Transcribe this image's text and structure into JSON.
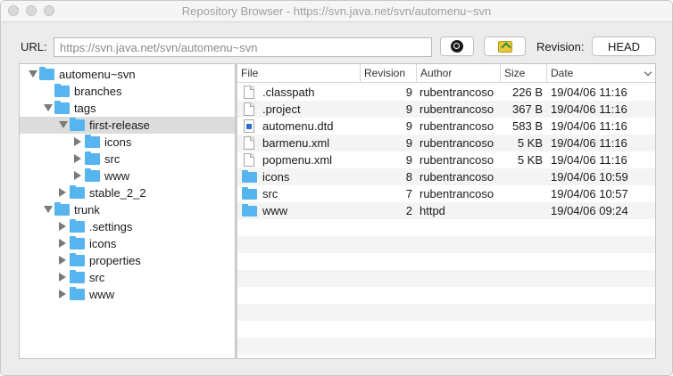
{
  "window": {
    "title": "Repository Browser - https://svn.java.net/svn/automenu~svn"
  },
  "toolbar": {
    "url_label": "URL:",
    "url_value": "https://svn.java.net/svn/automenu~svn",
    "search_icon": "search-icon",
    "open_icon": "open-folder-icon",
    "revision_label": "Revision:",
    "revision_button": "HEAD"
  },
  "tree": {
    "items": [
      {
        "label": "automenu~svn",
        "expander": "down"
      },
      {
        "label": "branches",
        "expander": "none"
      },
      {
        "label": "tags",
        "expander": "down"
      },
      {
        "label": "first-release",
        "expander": "down",
        "selected": true
      },
      {
        "label": "icons",
        "expander": "right"
      },
      {
        "label": "src",
        "expander": "right"
      },
      {
        "label": "www",
        "expander": "right"
      },
      {
        "label": "stable_2_2",
        "expander": "right"
      },
      {
        "label": "trunk",
        "expander": "down"
      },
      {
        "label": ".settings",
        "expander": "right"
      },
      {
        "label": "icons",
        "expander": "right"
      },
      {
        "label": "properties",
        "expander": "right"
      },
      {
        "label": "src",
        "expander": "right"
      },
      {
        "label": "www",
        "expander": "right"
      }
    ]
  },
  "files": {
    "columns": [
      "File",
      "Revision",
      "Author",
      "Size",
      "Date"
    ],
    "rows": [
      {
        "name": ".classpath",
        "icon": "document-icon",
        "revision": "9",
        "author": "rubentrancoso",
        "size": "226 B",
        "date": "19/04/06 11:16"
      },
      {
        "name": ".project",
        "icon": "document-icon",
        "revision": "9",
        "author": "rubentrancoso",
        "size": "367 B",
        "date": "19/04/06 11:16"
      },
      {
        "name": "automenu.dtd",
        "icon": "dtd-file-icon",
        "revision": "9",
        "author": "rubentrancoso",
        "size": "583 B",
        "date": "19/04/06 11:16"
      },
      {
        "name": "barmenu.xml",
        "icon": "document-icon",
        "revision": "9",
        "author": "rubentrancoso",
        "size": "5 KB",
        "date": "19/04/06 11:16"
      },
      {
        "name": "popmenu.xml",
        "icon": "document-icon",
        "revision": "9",
        "author": "rubentrancoso",
        "size": "5 KB",
        "date": "19/04/06 11:16"
      },
      {
        "name": "icons",
        "icon": "folder-icon",
        "revision": "8",
        "author": "rubentrancoso",
        "size": "",
        "date": "19/04/06 10:59"
      },
      {
        "name": "src",
        "icon": "folder-icon",
        "revision": "7",
        "author": "rubentrancoso",
        "size": "",
        "date": "19/04/06 10:57"
      },
      {
        "name": "www",
        "icon": "folder-icon",
        "revision": "2",
        "author": "httpd",
        "size": "",
        "date": "19/04/06 09:24"
      }
    ]
  },
  "colors": {
    "folder": "#56b4ee",
    "selection": "#dcdcdc",
    "alt_row": "#f4f4f4"
  }
}
